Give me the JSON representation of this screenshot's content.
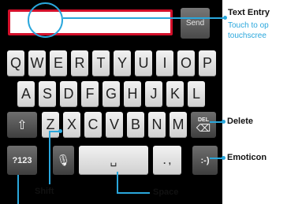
{
  "text_entry": {
    "value": ""
  },
  "send_label": "Send",
  "rows": {
    "row1": [
      "Q",
      "W",
      "E",
      "R",
      "T",
      "Y",
      "U",
      "I",
      "O",
      "P"
    ],
    "row2": [
      "A",
      "S",
      "D",
      "F",
      "G",
      "H",
      "J",
      "K",
      "L"
    ],
    "row3": [
      "Z",
      "X",
      "C",
      "V",
      "B",
      "N",
      "M"
    ]
  },
  "delete_label": "DEL",
  "symbols_label": "?123",
  "punct_label": ". ,",
  "emoticon_label": ":-)",
  "callouts": {
    "text_entry_title": "Text Entry",
    "text_entry_desc1": "Touch to op",
    "text_entry_desc2": "touchscree",
    "delete": "Delete",
    "emoticon": "Emoticon",
    "shift": "Shift",
    "space": "Space"
  },
  "colors": {
    "accent": "#2aa7dc",
    "entry_border": "#d40f2a"
  }
}
